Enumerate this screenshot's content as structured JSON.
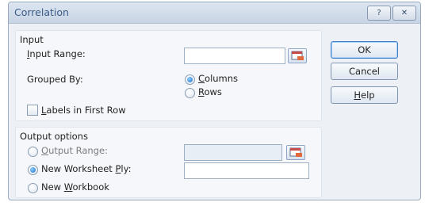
{
  "window": {
    "title": "Correlation",
    "help_glyph": "?",
    "close_glyph": "✕"
  },
  "input": {
    "section_label": "Input",
    "input_range": {
      "label_pre": "",
      "label_ul": "I",
      "label_post": "nput Range:",
      "value": ""
    },
    "grouped_by": {
      "label": "Grouped By:",
      "columns": {
        "ul": "C",
        "rest": "olumns",
        "selected": true
      },
      "rows": {
        "ul": "R",
        "rest": "ows",
        "selected": false
      }
    },
    "labels_first_row": {
      "ul": "L",
      "rest": "abels in First Row",
      "checked": false
    }
  },
  "output": {
    "section_label": "Output options",
    "output_range": {
      "ul": "O",
      "rest": "utput Range:",
      "selected": false,
      "value": ""
    },
    "new_worksheet": {
      "pre": "New Worksheet ",
      "ul": "P",
      "rest": "ly:",
      "selected": true,
      "value": ""
    },
    "new_workbook": {
      "pre": "New ",
      "ul": "W",
      "rest": "orkbook",
      "selected": false
    }
  },
  "buttons": {
    "ok": "OK",
    "cancel": "Cancel",
    "help_pre": "",
    "help_ul": "H",
    "help_post": "elp"
  },
  "colors": {
    "title_text": "#3b5b87",
    "radio_fill": "#1f6fc7",
    "default_button_border": "#3d7cc4"
  }
}
